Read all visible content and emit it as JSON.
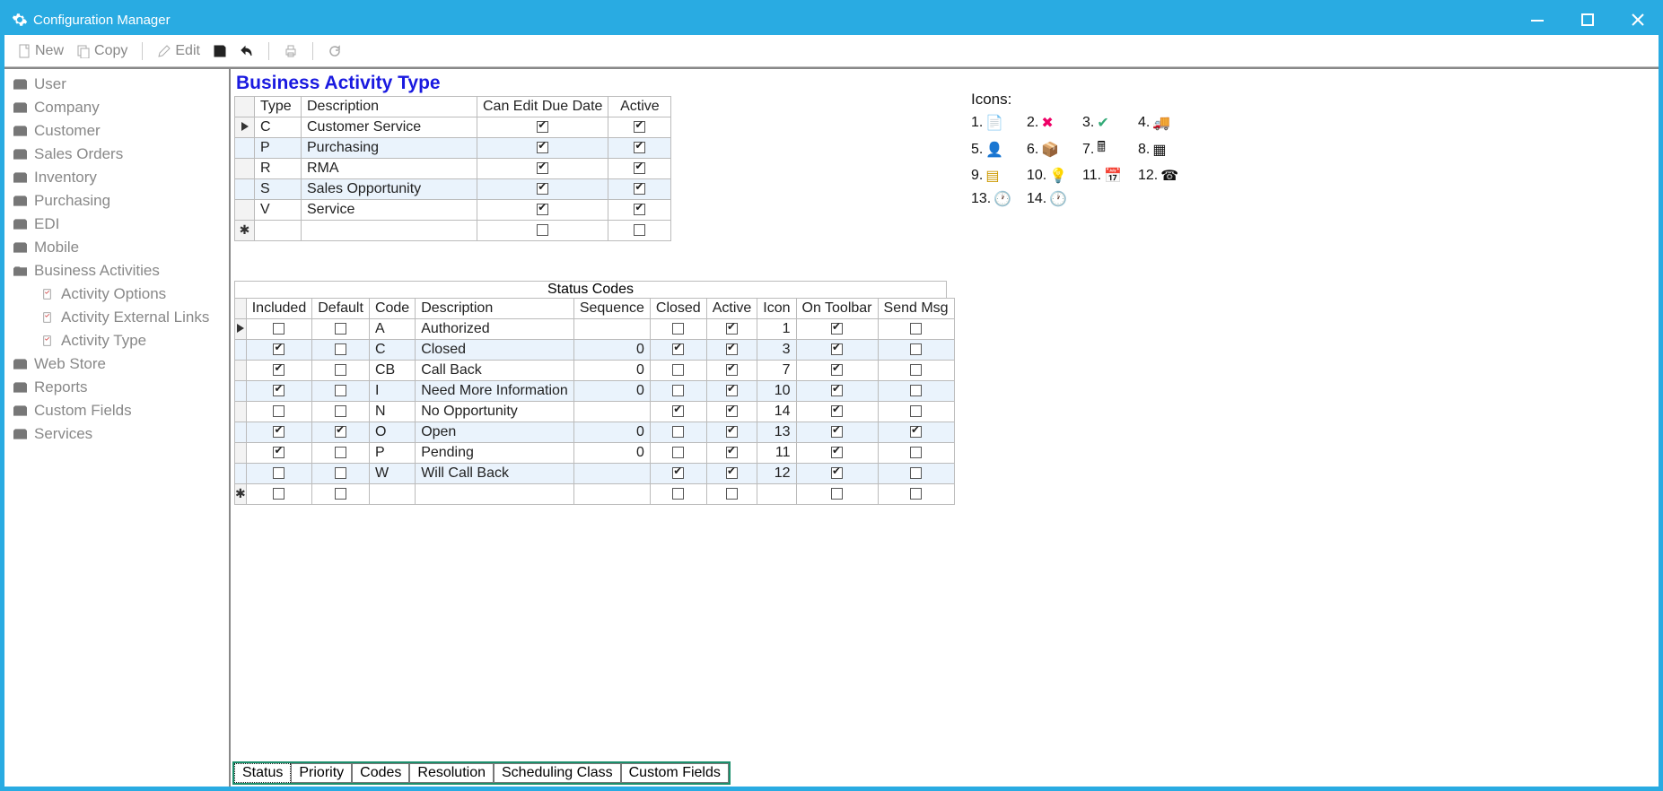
{
  "window": {
    "title": "Configuration Manager"
  },
  "toolbar": {
    "new": "New",
    "copy": "Copy",
    "edit": "Edit"
  },
  "sidebar": {
    "items": [
      "User",
      "Company",
      "Customer",
      "Sales Orders",
      "Inventory",
      "Purchasing",
      "EDI",
      "Mobile",
      "Business Activities"
    ],
    "subitems": [
      "Activity Options",
      "Activity External Links",
      "Activity Type"
    ],
    "items2": [
      "Web Store",
      "Reports",
      "Custom Fields",
      "Services"
    ]
  },
  "page": {
    "title": "Business Activity Type"
  },
  "icons_label": "Icons:",
  "icon_numbers": [
    "1.",
    "2.",
    "3.",
    "4.",
    "5.",
    "6.",
    "7.",
    "8.",
    "9.",
    "10.",
    "11.",
    "12.",
    "13.",
    "14."
  ],
  "activity_type_table": {
    "headers": [
      "Type",
      "Description",
      "Can Edit Due Date",
      "Active"
    ],
    "rows": [
      {
        "type": "C",
        "desc": "Customer Service",
        "can_edit": true,
        "active": true,
        "selected": true
      },
      {
        "type": "P",
        "desc": "Purchasing",
        "can_edit": true,
        "active": true
      },
      {
        "type": "R",
        "desc": "RMA",
        "can_edit": true,
        "active": true
      },
      {
        "type": "S",
        "desc": "Sales Opportunity",
        "can_edit": true,
        "active": true
      },
      {
        "type": "V",
        "desc": "Service",
        "can_edit": true,
        "active": true
      }
    ]
  },
  "status_codes": {
    "title": "Status Codes",
    "headers": [
      "Included",
      "Default",
      "Code",
      "Description",
      "Sequence",
      "Closed",
      "Active",
      "Icon",
      "On Toolbar",
      "Send Msg"
    ],
    "rows": [
      {
        "included": false,
        "default": false,
        "code": "A",
        "desc": "Authorized",
        "seq": "",
        "closed": false,
        "active": true,
        "icon": "1",
        "on_toolbar": true,
        "send": false,
        "selected": true
      },
      {
        "included": true,
        "default": false,
        "code": "C",
        "desc": "Closed",
        "seq": "0",
        "closed": true,
        "active": true,
        "icon": "3",
        "on_toolbar": true,
        "send": false
      },
      {
        "included": true,
        "default": false,
        "code": "CB",
        "desc": "Call Back",
        "seq": "0",
        "closed": false,
        "active": true,
        "icon": "7",
        "on_toolbar": true,
        "send": false
      },
      {
        "included": true,
        "default": false,
        "code": "I",
        "desc": "Need More Information",
        "seq": "0",
        "closed": false,
        "active": true,
        "icon": "10",
        "on_toolbar": true,
        "send": false
      },
      {
        "included": false,
        "default": false,
        "code": "N",
        "desc": "No Opportunity",
        "seq": "",
        "closed": true,
        "active": true,
        "icon": "14",
        "on_toolbar": true,
        "send": false
      },
      {
        "included": true,
        "default": true,
        "code": "O",
        "desc": "Open",
        "seq": "0",
        "closed": false,
        "active": true,
        "icon": "13",
        "on_toolbar": true,
        "send": true
      },
      {
        "included": true,
        "default": false,
        "code": "P",
        "desc": "Pending",
        "seq": "0",
        "closed": false,
        "active": true,
        "icon": "11",
        "on_toolbar": true,
        "send": false
      },
      {
        "included": false,
        "default": false,
        "code": "W",
        "desc": "Will Call Back",
        "seq": "",
        "closed": true,
        "active": true,
        "icon": "12",
        "on_toolbar": true,
        "send": false
      }
    ]
  },
  "tabs": [
    "Status",
    "Priority",
    "Codes",
    "Resolution",
    "Scheduling Class",
    "Custom Fields"
  ]
}
